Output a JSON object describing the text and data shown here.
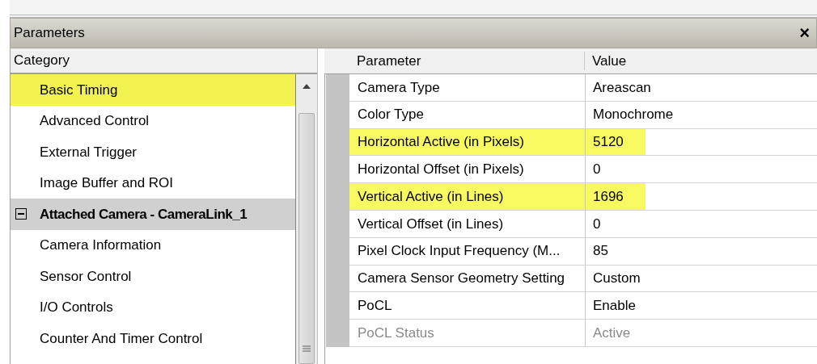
{
  "panel": {
    "title": "Parameters",
    "close": "×"
  },
  "category": {
    "header": "Category",
    "items": [
      {
        "label": "Basic Timing",
        "kind": "item",
        "highlighted": true
      },
      {
        "label": "Advanced Control",
        "kind": "item",
        "highlighted": false
      },
      {
        "label": "External Trigger",
        "kind": "item",
        "highlighted": false
      },
      {
        "label": "Image Buffer and ROI",
        "kind": "item",
        "highlighted": false
      },
      {
        "label": "Attached Camera - CameraLink_1",
        "kind": "group",
        "expanded": true,
        "highlighted": false
      },
      {
        "label": "Camera Information",
        "kind": "item",
        "highlighted": false
      },
      {
        "label": "Sensor Control",
        "kind": "item",
        "highlighted": false
      },
      {
        "label": "I/O Controls",
        "kind": "item",
        "highlighted": false
      },
      {
        "label": "Counter And Timer Control",
        "kind": "item",
        "highlighted": false
      }
    ]
  },
  "grid": {
    "columns": [
      "Parameter",
      "Value"
    ],
    "rows": [
      {
        "parameter": "Camera Type",
        "value": "Areascan",
        "highlighted": false,
        "disabled": false
      },
      {
        "parameter": "Color Type",
        "value": "Monochrome",
        "highlighted": false,
        "disabled": false
      },
      {
        "parameter": "Horizontal Active (in Pixels)",
        "value": "5120",
        "highlighted": true,
        "disabled": false
      },
      {
        "parameter": "Horizontal Offset (in Pixels)",
        "value": "0",
        "highlighted": false,
        "disabled": false
      },
      {
        "parameter": "Vertical Active (in Lines)",
        "value": "1696",
        "highlighted": true,
        "disabled": false
      },
      {
        "parameter": "Vertical Offset (in Lines)",
        "value": "0",
        "highlighted": false,
        "disabled": false
      },
      {
        "parameter": "Pixel Clock Input Frequency (M...",
        "value": "85",
        "highlighted": false,
        "disabled": false
      },
      {
        "parameter": "Camera Sensor Geometry Setting",
        "value": "Custom",
        "highlighted": false,
        "disabled": false
      },
      {
        "parameter": "PoCL",
        "value": "Enable",
        "highlighted": false,
        "disabled": false
      },
      {
        "parameter": "PoCL Status",
        "value": "Active",
        "highlighted": false,
        "disabled": true
      }
    ]
  }
}
